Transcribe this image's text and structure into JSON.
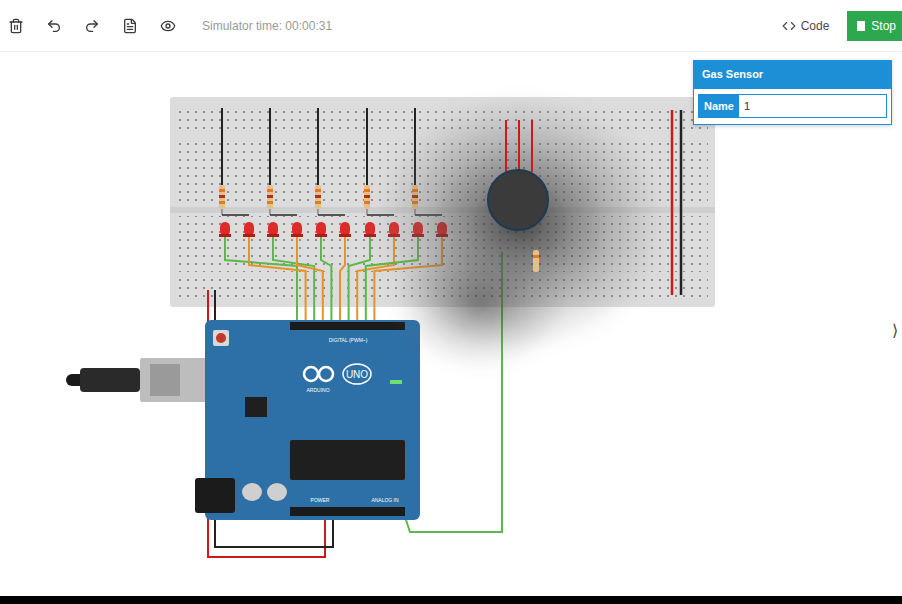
{
  "toolbar": {
    "simulator_time": "Simulator time: 00:00:31",
    "code_button": "Code",
    "stop_button": "Stop",
    "running": true
  },
  "inspector": {
    "title": "Gas Sensor",
    "fields": [
      {
        "label": "Name",
        "value": "1"
      }
    ]
  },
  "board": {
    "logo": "UNO",
    "brand": "ARDUINO",
    "digital_label": "DIGITAL (PWM~)",
    "power_label": "POWER",
    "analog_label": "ANALOG IN"
  },
  "side_toggle": "⟩"
}
